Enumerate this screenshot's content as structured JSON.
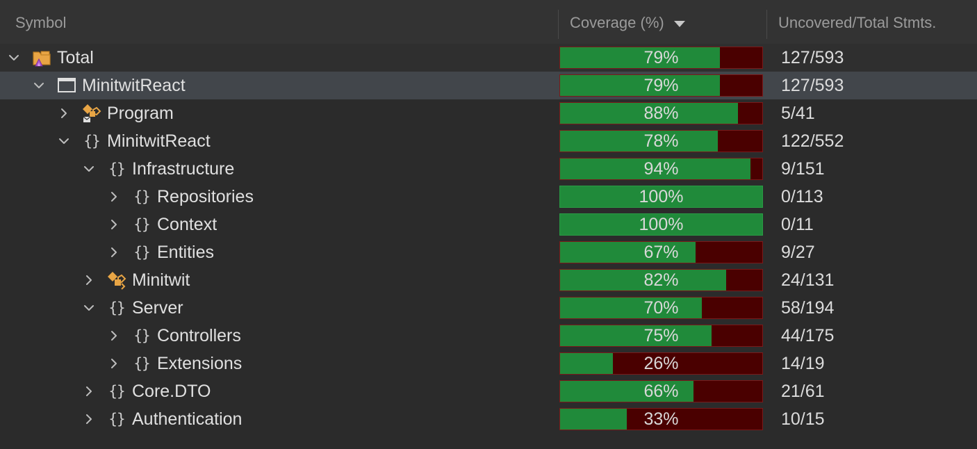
{
  "header": {
    "symbol": "Symbol",
    "coverage": "Coverage (%)",
    "stmts": "Uncovered/Total Stmts."
  },
  "colors": {
    "covered": "#208a3a",
    "uncovered": "#4a0000",
    "selected_row": "#42464b"
  },
  "rows": [
    {
      "name": "Total",
      "level": 0,
      "expanded": true,
      "icon": "solution-folder-icon",
      "coverage": 79,
      "coverage_label": "79%",
      "stmts": "127/593",
      "state": "first"
    },
    {
      "name": "MinitwitReact",
      "level": 1,
      "expanded": true,
      "icon": "project-window-icon",
      "coverage": 79,
      "coverage_label": "79%",
      "stmts": "127/593",
      "state": "selected"
    },
    {
      "name": "Program",
      "level": 2,
      "expanded": false,
      "icon": "program-class-icon",
      "coverage": 88,
      "coverage_label": "88%",
      "stmts": "5/41"
    },
    {
      "name": "MinitwitReact",
      "level": 2,
      "expanded": true,
      "icon": "namespace-icon",
      "coverage": 78,
      "coverage_label": "78%",
      "stmts": "122/552"
    },
    {
      "name": "Infrastructure",
      "level": 3,
      "expanded": true,
      "icon": "namespace-icon",
      "coverage": 94,
      "coverage_label": "94%",
      "stmts": "9/151"
    },
    {
      "name": "Repositories",
      "level": 4,
      "expanded": false,
      "icon": "namespace-icon",
      "coverage": 100,
      "coverage_label": "100%",
      "stmts": "0/113"
    },
    {
      "name": "Context",
      "level": 4,
      "expanded": false,
      "icon": "namespace-icon",
      "coverage": 100,
      "coverage_label": "100%",
      "stmts": "0/11"
    },
    {
      "name": "Entities",
      "level": 4,
      "expanded": false,
      "icon": "namespace-icon",
      "coverage": 67,
      "coverage_label": "67%",
      "stmts": "9/27"
    },
    {
      "name": "Minitwit",
      "level": 3,
      "expanded": false,
      "icon": "class-icon",
      "coverage": 82,
      "coverage_label": "82%",
      "stmts": "24/131"
    },
    {
      "name": "Server",
      "level": 3,
      "expanded": true,
      "icon": "namespace-icon",
      "coverage": 70,
      "coverage_label": "70%",
      "stmts": "58/194"
    },
    {
      "name": "Controllers",
      "level": 4,
      "expanded": false,
      "icon": "namespace-icon",
      "coverage": 75,
      "coverage_label": "75%",
      "stmts": "44/175"
    },
    {
      "name": "Extensions",
      "level": 4,
      "expanded": false,
      "icon": "namespace-icon",
      "coverage": 26,
      "coverage_label": "26%",
      "stmts": "14/19"
    },
    {
      "name": "Core.DTO",
      "level": 3,
      "expanded": false,
      "icon": "namespace-icon",
      "coverage": 66,
      "coverage_label": "66%",
      "stmts": "21/61"
    },
    {
      "name": "Authentication",
      "level": 3,
      "expanded": false,
      "icon": "namespace-icon",
      "coverage": 33,
      "coverage_label": "33%",
      "stmts": "10/15"
    }
  ]
}
